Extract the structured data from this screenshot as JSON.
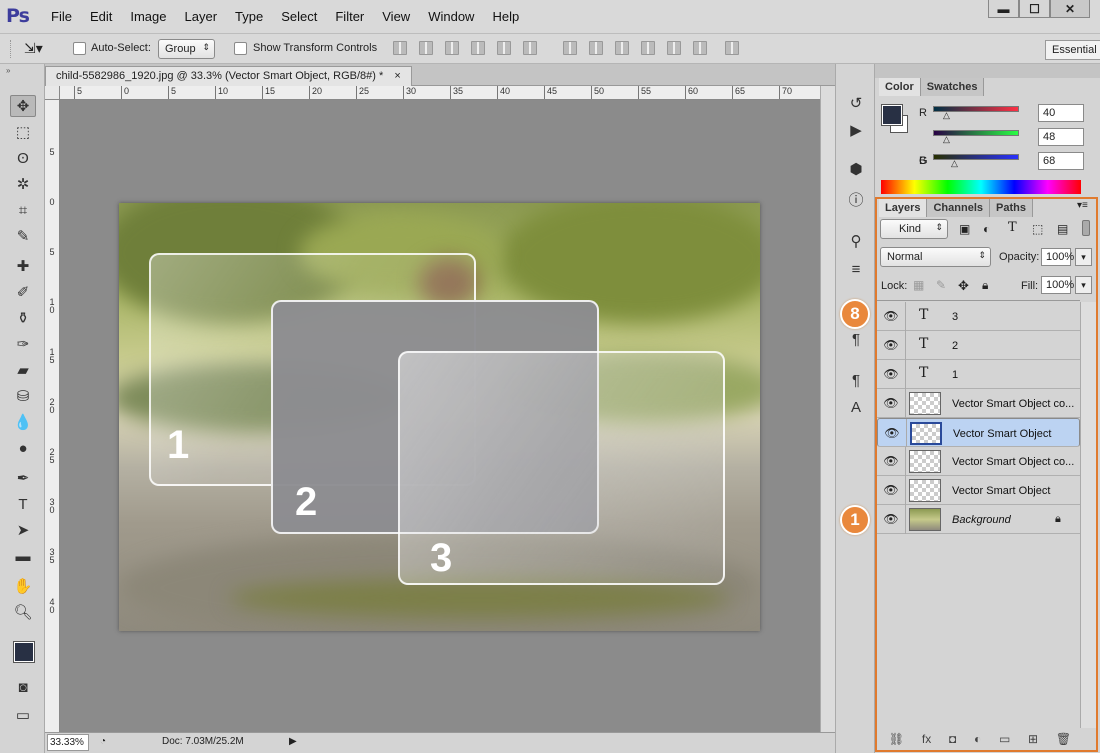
{
  "menubar": {
    "logo": "Ps",
    "items": [
      "File",
      "Edit",
      "Image",
      "Layer",
      "Type",
      "Select",
      "Filter",
      "View",
      "Window",
      "Help"
    ],
    "window_buttons": [
      "▬",
      "☐",
      "✕"
    ]
  },
  "options": {
    "auto_select_label": "Auto-Select:",
    "group_value": "Group",
    "transform_label": "Show Transform Controls",
    "workspace": "Essential"
  },
  "document": {
    "tab_title": "child-5582986_1920.jpg @ 33.3% (Vector Smart Object, RGB/8#) *",
    "close": "×",
    "ruler_h": [
      "5",
      "0",
      "5",
      "10",
      "15",
      "20",
      "25",
      "30",
      "35",
      "40",
      "45",
      "50",
      "55",
      "60",
      "65",
      "70"
    ],
    "ruler_v": [
      "5",
      "0",
      "5",
      "1 0",
      "1 5",
      "2 0",
      "2 5",
      "3 0",
      "3 5",
      "4 0"
    ],
    "zoom": "33.33%",
    "doc_info": "Doc: 7.03M/25.2M",
    "cards": [
      "1",
      "2",
      "3"
    ]
  },
  "color_panel": {
    "tabs": [
      "Color",
      "Swatches"
    ],
    "r_label": "R",
    "r_value": "40",
    "g_label": "G",
    "g_value": "48",
    "b_label": "B",
    "b_value": "68",
    "fg_color": "#283044"
  },
  "layers_panel": {
    "tabs": [
      "Layers",
      "Channels",
      "Paths"
    ],
    "kind": "Kind",
    "blend": "Normal",
    "opacity_label": "Opacity:",
    "opacity": "100%",
    "lock_label": "Lock:",
    "fill_label": "Fill:",
    "fill": "100%",
    "layers": [
      {
        "name": "3",
        "type": "text"
      },
      {
        "name": "2",
        "type": "text"
      },
      {
        "name": "1",
        "type": "text"
      },
      {
        "name": "Vector Smart Object co...",
        "type": "smart"
      },
      {
        "name": "Vector Smart Object",
        "type": "smart",
        "selected": true
      },
      {
        "name": "Vector Smart Object co...",
        "type": "smart"
      },
      {
        "name": "Vector Smart Object",
        "type": "smart"
      },
      {
        "name": "Background",
        "type": "image",
        "locked": true
      }
    ]
  },
  "badges": {
    "top": "8",
    "bottom": "1"
  },
  "accent": "#e07a2e"
}
